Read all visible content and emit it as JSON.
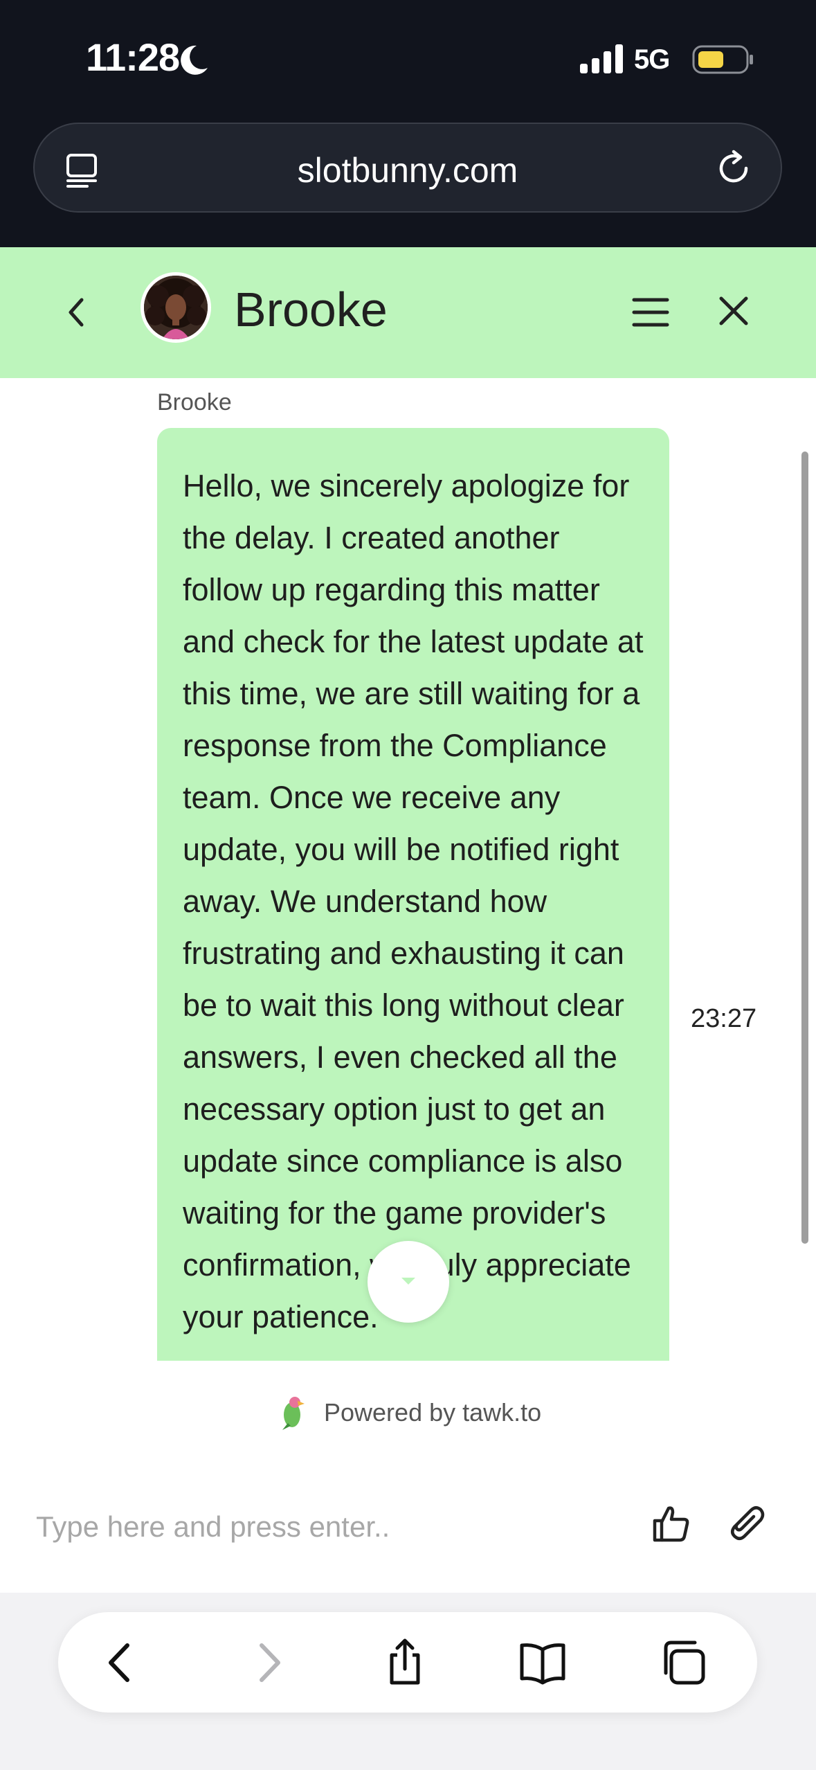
{
  "status_bar": {
    "time": "11:28",
    "network": "5G"
  },
  "browser": {
    "url": "slotbunny.com"
  },
  "chat": {
    "agent_name": "Brooke",
    "sender_label": "Brooke",
    "message": "Hello, we sincerely apologize for the delay. I created another follow up regarding this matter and check for the latest update at this time, we are still waiting for a response from the Compliance team. Once we receive any update, you will be notified right away. We understand how frustrating and exhausting it can be to wait this long without clear answers, I even checked all the necessary option just to get an update since compliance is also waiting for the game provider's confirmation, we truly appreciate your patience.",
    "message_time": "23:27"
  },
  "footer": {
    "powered_by": "Powered by tawk.to",
    "input_placeholder": "Type here and press enter.."
  },
  "colors": {
    "header_bg": "#bdf5bc",
    "bubble_bg": "#bdf5bc",
    "top_bar_bg": "#11141d",
    "battery": "#f5d547"
  }
}
